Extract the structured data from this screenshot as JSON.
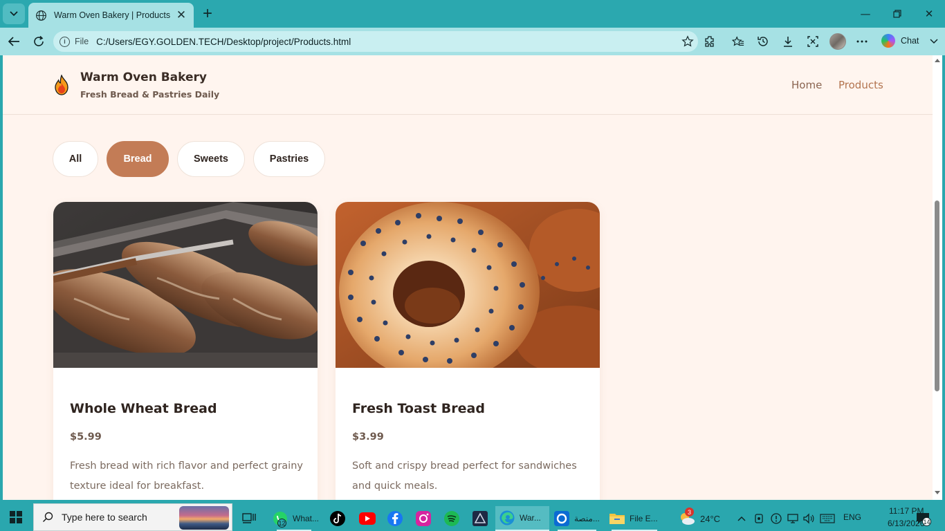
{
  "browser": {
    "tab_title": "Warm Oven Bakery | Products",
    "address_scheme": "File",
    "address_url": "C:/Users/EGY.GOLDEN.TECH/Desktop/project/Products.html",
    "copilot_label": "Chat"
  },
  "site": {
    "brand_name": "Warm Oven Bakery",
    "tagline": "Fresh Bread & Pastries Daily",
    "nav": [
      {
        "label": "Home"
      },
      {
        "label": "Products"
      }
    ],
    "filters": [
      {
        "label": "All"
      },
      {
        "label": "Bread"
      },
      {
        "label": "Sweets"
      },
      {
        "label": "Pastries"
      }
    ],
    "active_filter": "Bread",
    "products": [
      {
        "name": "Whole Wheat Bread",
        "price": "$5.99",
        "description": "Fresh bread with rich flavor and perfect grainy texture ideal for breakfast."
      },
      {
        "name": "Fresh Toast Bread",
        "price": "$3.99",
        "description": "Soft and crispy bread perfect for sandwiches and quick meals."
      }
    ]
  },
  "taskbar": {
    "search_placeholder": "Type here to search",
    "apps": [
      {
        "label": "What...",
        "badge": "12"
      },
      {
        "label": "War..."
      },
      {
        "label": "منصة..."
      },
      {
        "label": "File E..."
      }
    ],
    "weather": "24°C",
    "weather_badge": "3",
    "language": "ENG",
    "time": "11:17 PM",
    "date": "6/13/2026",
    "notifications": "14"
  },
  "colors": {
    "browser_frame": "#2aa7ae",
    "page_background": "#fff4ee",
    "accent": "#c37c56",
    "nav_link": "#8a6450"
  }
}
